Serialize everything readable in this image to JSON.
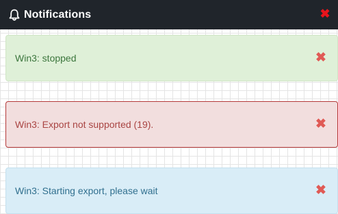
{
  "header": {
    "title": "Notifications",
    "icon": "bell-icon",
    "close_glyph": "✖",
    "close_color": "#e8141c",
    "background": "#20252b"
  },
  "notifications": [
    {
      "type": "success",
      "message": "Win3: stopped",
      "close_glyph": "✖"
    },
    {
      "type": "danger",
      "message": "Win3: Export not supported (19).",
      "close_glyph": "✖"
    },
    {
      "type": "info",
      "message": "Win3: Starting export, please wait",
      "close_glyph": "✖"
    }
  ],
  "colors": {
    "success_bg": "#dff0d8",
    "danger_bg": "#f2dede",
    "info_bg": "#d9edf7",
    "close_x": "#e05a55"
  }
}
